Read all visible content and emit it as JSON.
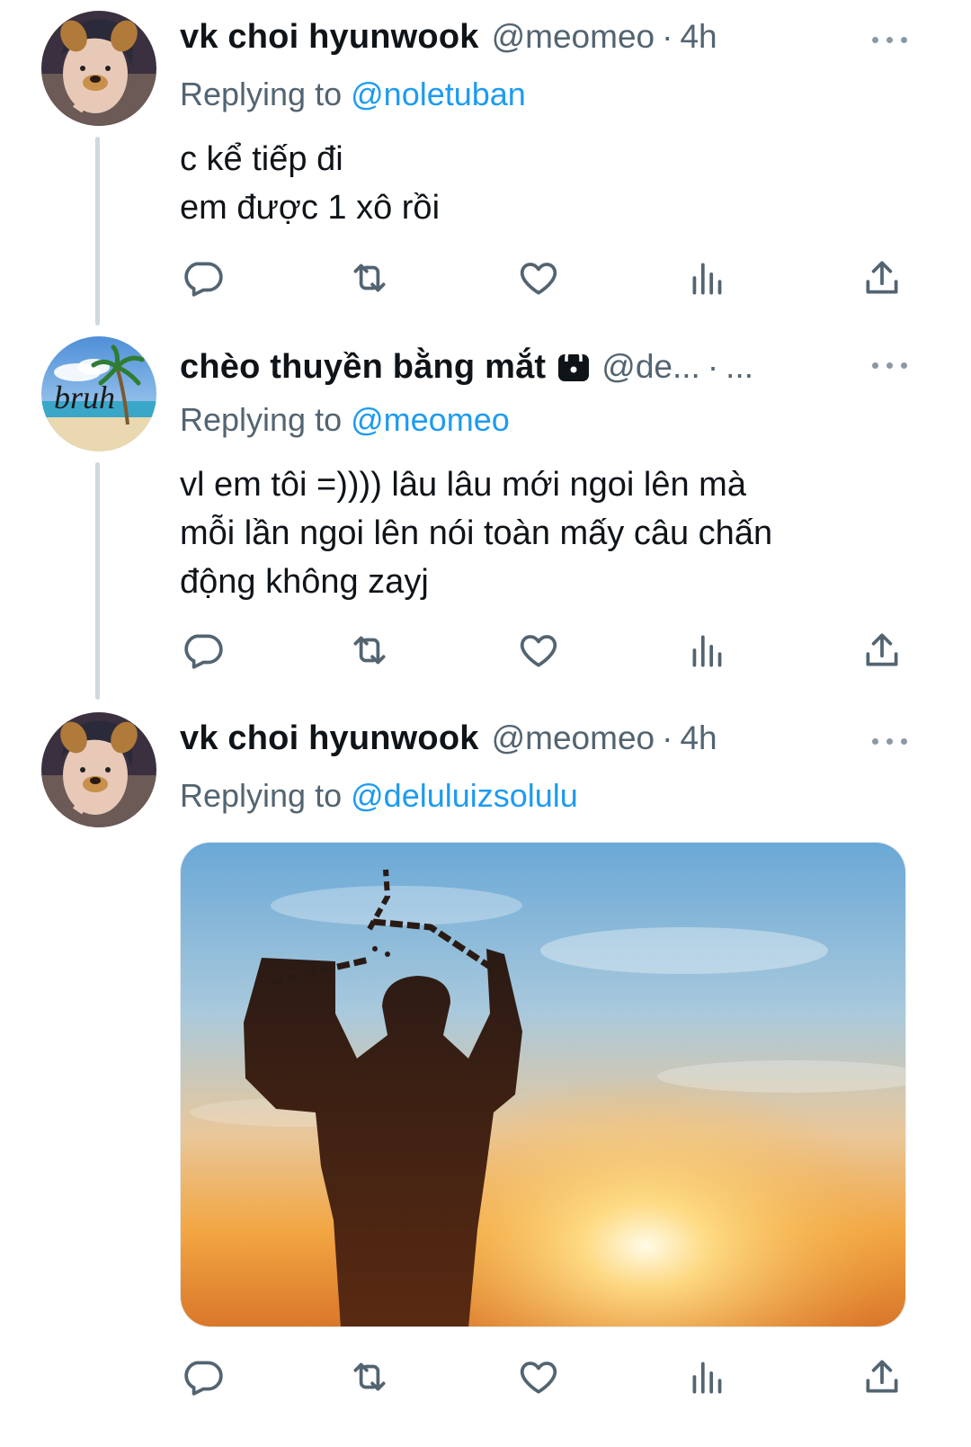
{
  "tweets": [
    {
      "author_name": "vk choi hyunwook",
      "handle": "@meomeo",
      "separator": "·",
      "time": "4h",
      "replying_prefix": "Replying to",
      "replying_to": "@noletuban",
      "text_lines": [
        "c kể tiếp đi",
        "em được 1 xô rồi"
      ],
      "avatar": "face-with-dog-filter"
    },
    {
      "author_name": "chèo thuyền bằng mắt",
      "protected_icon": "lock-icon",
      "handle": "@de...",
      "separator": "·",
      "time": "...",
      "replying_prefix": "Replying to",
      "replying_to": "@meomeo",
      "text_lines": [
        "vl em tôi =)))) lâu lâu mới ngoi lên mà",
        "mỗi lần ngoi lên nói toàn mấy câu chấn",
        "động không zayj"
      ],
      "avatar": "beach-palm-tree",
      "avatar_text": "bruh"
    },
    {
      "author_name": "vk choi hyunwook",
      "handle": "@meomeo",
      "separator": "·",
      "time": "4h",
      "replying_prefix": "Replying to",
      "replying_to": "@deluluizsolulu",
      "media": "silhouette-breaking-chains-at-sunset",
      "avatar": "face-with-dog-filter"
    }
  ],
  "action_icons": [
    "reply-icon",
    "retweet-icon",
    "like-icon",
    "views-icon",
    "share-icon"
  ],
  "colors": {
    "text": "#0f1419",
    "secondary": "#536471",
    "mention": "#1d9bf0",
    "thread_line": "#cfd9de",
    "icon": "#536471"
  }
}
